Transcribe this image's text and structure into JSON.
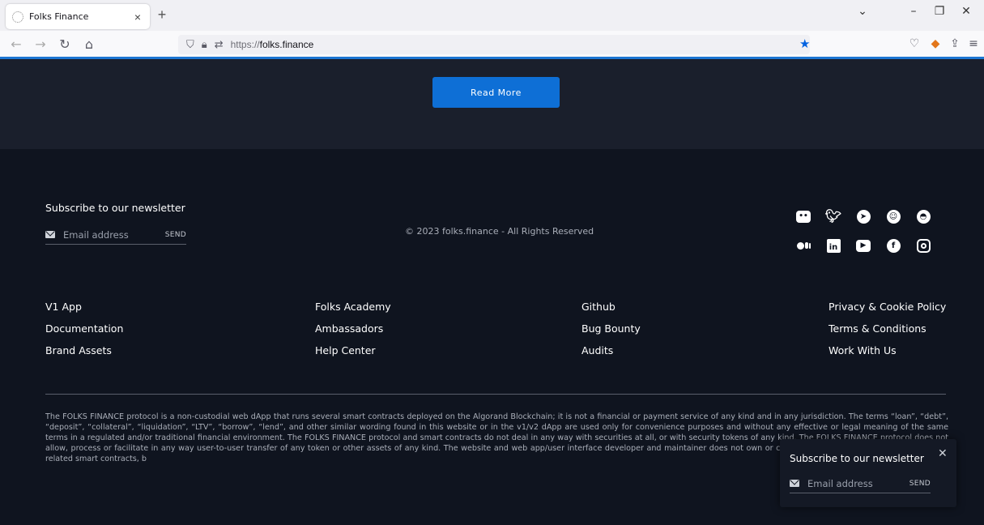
{
  "browser": {
    "tab_title": "Folks Finance",
    "tab_close": "×",
    "new_tab": "+",
    "url_prefix": "https://",
    "url_domain": "folks.finance",
    "controls": {
      "list": "⌄",
      "minimize": "–",
      "restore": "❐",
      "close": "✕"
    },
    "nav": {
      "back": "←",
      "forward": "→",
      "reload": "↻",
      "home": "⌂"
    },
    "accent_color": "#0061e0"
  },
  "page": {
    "read_more_label": "Read More",
    "newsletter": {
      "title": "Subscribe to our newsletter",
      "placeholder": "Email address",
      "send_label": "SEND"
    },
    "copyright": "© 2023 folks.finance - All Rights Reserved",
    "social_icons": [
      "discord",
      "twitter",
      "telegram",
      "reddit",
      "github",
      "medium",
      "linkedin",
      "youtube",
      "facebook",
      "instagram"
    ],
    "links": {
      "col1": [
        "V1 App",
        "Documentation",
        "Brand Assets"
      ],
      "col2": [
        "Folks Academy",
        "Ambassadors",
        "Help Center"
      ],
      "col3": [
        "Github",
        "Bug Bounty",
        "Audits"
      ],
      "col4": [
        "Privacy & Cookie Policy",
        "Terms & Conditions",
        "Work With Us"
      ]
    },
    "disclaimer": "The FOLKS FINANCE protocol is a non-custodial web dApp that runs several smart contracts deployed on the Algorand Blockchain; it is not a financial or payment service of any kind and in any jurisdiction. The terms “loan”, “debt”, “deposit”, “collateral”, “liquidation”, “LTV”, “borrow”, “lend”, and other similar wording found in this website or in the v1/v2 dApp are used only for convenience purposes and without any effective or legal meaning of the same terms in a regulated and/or traditional financial environment. The FOLKS FINANCE protocol and smart contracts do not deal in any way with securities at all, or with security tokens of any kind. The FOLKS FINANCE protocol does not allow, process or facilitate in any way user-to-user transfer of any token or other assets of any kind. The website and web app/user interface developer and maintainer does not own or control the Folks Finance protocol and/or its related smart contracts, b",
    "brand_button_color": "#0e6fd6"
  },
  "popup": {
    "title": "Subscribe to our newsletter",
    "close": "✕",
    "placeholder": "Email address",
    "send_label": "SEND"
  }
}
